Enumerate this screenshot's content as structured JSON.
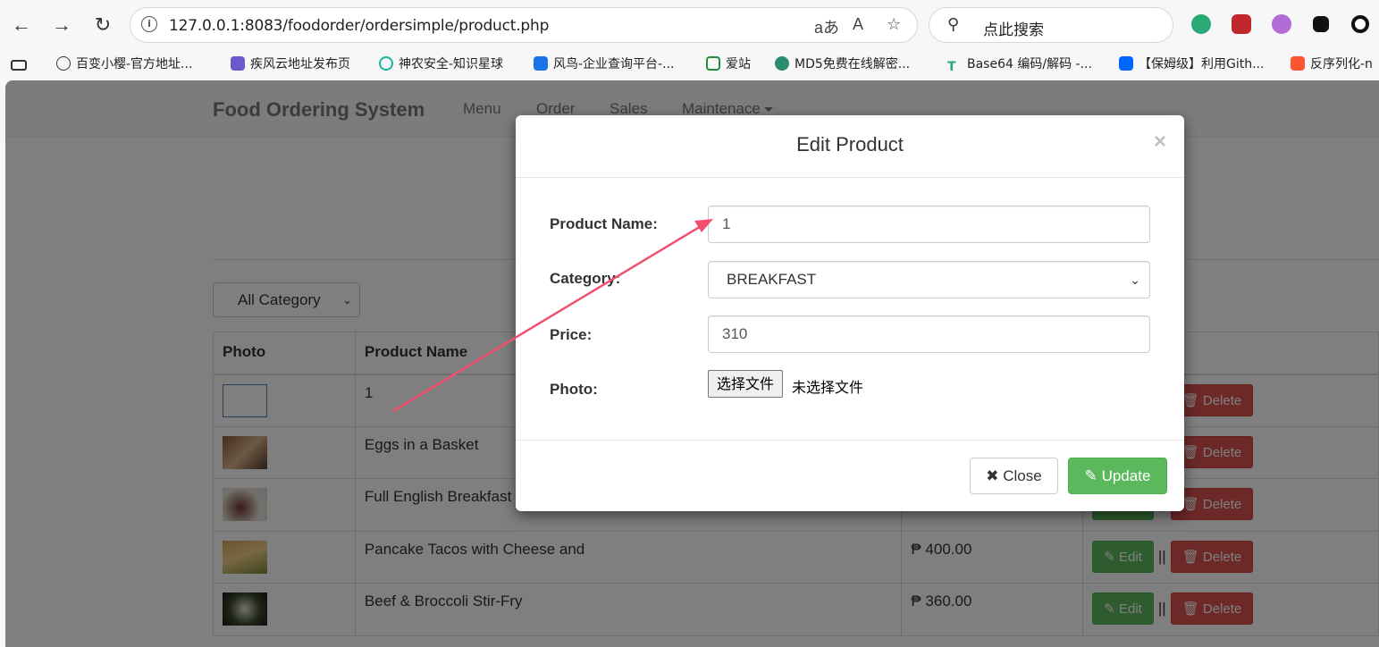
{
  "browser": {
    "url": "127.0.0.1:8083/foodorder/ordersimple/product.php",
    "search_placeholder": "点此搜索",
    "bookmarks": [
      "百变小樱-官方地址...",
      "疾风云地址发布页",
      "神农安全-知识星球",
      "风鸟-企业查询平台-...",
      "爱站",
      "MD5免费在线解密...",
      "Base64 编码/解码 -...",
      "【保姆级】利用Gith...",
      "反序列化-n"
    ],
    "colors": {
      "chrome_bg": "#f7f7f7",
      "bookmark_icon_1": "#6a5acd"
    }
  },
  "navbar": {
    "brand": "Food Ordering System",
    "links": [
      "Menu",
      "Order",
      "Sales",
      "Maintenace"
    ]
  },
  "filter": {
    "category_selected": "All Category"
  },
  "table": {
    "headers": [
      "Photo",
      "Product Name"
    ],
    "rows": [
      {
        "name": "1",
        "price": ""
      },
      {
        "name": "Eggs in a Basket",
        "price": ""
      },
      {
        "name": "Full English Breakfast",
        "price": ""
      },
      {
        "name": "Pancake Tacos with Cheese and",
        "price": "₱ 400.00"
      },
      {
        "name": "Beef & Broccoli Stir-Fry",
        "price": "₱ 360.00"
      }
    ],
    "edit_label": "Edit",
    "delete_label": "Delete",
    "separator": "||"
  },
  "modal": {
    "title": "Edit Product",
    "close_symbol": "×",
    "fields": {
      "product_name_label": "Product Name:",
      "product_name_value": "1",
      "category_label": "Category:",
      "category_value": "BREAKFAST",
      "price_label": "Price:",
      "price_value": "310",
      "photo_label": "Photo:",
      "file_button": "选择文件",
      "file_status": "未选择文件"
    },
    "close_button": "Close",
    "update_button": "Update"
  },
  "colors": {
    "success": "#5cb85c",
    "danger": "#d9534f",
    "annotation_arrow": "#f0506e"
  }
}
